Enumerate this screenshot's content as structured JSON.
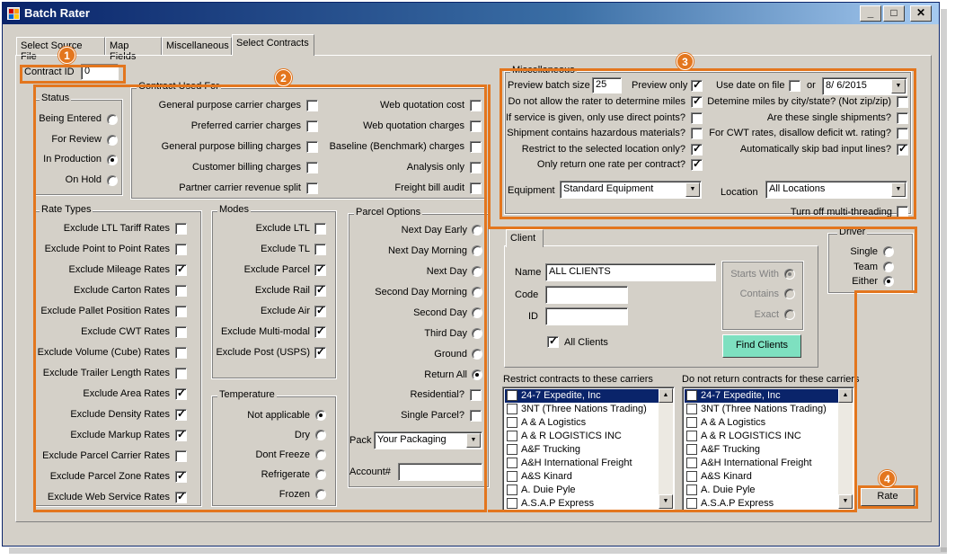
{
  "window": {
    "title": "Batch Rater",
    "minimize": "_",
    "maximize": "□",
    "close": "✕"
  },
  "tabs": [
    {
      "label": "Select Source File"
    },
    {
      "label": "Map Fields"
    },
    {
      "label": "Miscellaneous"
    },
    {
      "label": "Select Contracts"
    }
  ],
  "contract_id": {
    "label": "Contract ID",
    "value": "0"
  },
  "badges": [
    "1",
    "2",
    "3",
    "4"
  ],
  "status": {
    "title": "Status",
    "options": [
      {
        "label": "Being Entered",
        "selected": false
      },
      {
        "label": "For Review",
        "selected": false
      },
      {
        "label": "In Production",
        "selected": true
      },
      {
        "label": "On Hold",
        "selected": false
      }
    ]
  },
  "contract_used_for": {
    "title": "Contract Used For",
    "left": [
      {
        "label": "General purpose carrier charges",
        "checked": false
      },
      {
        "label": "Preferred carrier charges",
        "checked": false
      },
      {
        "label": "General purpose billing charges",
        "checked": false
      },
      {
        "label": "Customer billing charges",
        "checked": false
      },
      {
        "label": "Partner carrier revenue split",
        "checked": false
      }
    ],
    "right": [
      {
        "label": "Web quotation cost",
        "checked": false
      },
      {
        "label": "Web quotation charges",
        "checked": false
      },
      {
        "label": "Baseline (Benchmark) charges",
        "checked": false
      },
      {
        "label": "Analysis only",
        "checked": false
      },
      {
        "label": "Freight bill audit",
        "checked": false
      }
    ]
  },
  "rate_types": {
    "title": "Rate Types",
    "items": [
      {
        "label": "Exclude LTL Tariff Rates",
        "checked": false
      },
      {
        "label": "Exclude Point to Point Rates",
        "checked": false
      },
      {
        "label": "Exclude Mileage Rates",
        "checked": true
      },
      {
        "label": "Exclude Carton Rates",
        "checked": false
      },
      {
        "label": "Exclude Pallet Position Rates",
        "checked": false
      },
      {
        "label": "Exclude CWT Rates",
        "checked": false
      },
      {
        "label": "Exclude Volume (Cube) Rates",
        "checked": false
      },
      {
        "label": "Exclude Trailer Length Rates",
        "checked": false
      },
      {
        "label": "Exclude Area Rates",
        "checked": true
      },
      {
        "label": "Exclude Density Rates",
        "checked": true
      },
      {
        "label": "Exclude Markup Rates",
        "checked": true
      },
      {
        "label": "Exclude Parcel Carrier Rates",
        "checked": false
      },
      {
        "label": "Exclude Parcel Zone Rates",
        "checked": true
      },
      {
        "label": "Exclude Web Service Rates",
        "checked": true
      }
    ]
  },
  "modes": {
    "title": "Modes",
    "items": [
      {
        "label": "Exclude LTL",
        "checked": false
      },
      {
        "label": "Exclude TL",
        "checked": false
      },
      {
        "label": "Exclude Parcel",
        "checked": true
      },
      {
        "label": "Exclude Rail",
        "checked": true
      },
      {
        "label": "Exclude Air",
        "checked": true
      },
      {
        "label": "Exclude Multi-modal",
        "checked": true
      },
      {
        "label": "Exclude Post (USPS)",
        "checked": true
      }
    ]
  },
  "temperature": {
    "title": "Temperature",
    "options": [
      {
        "label": "Not applicable",
        "selected": true
      },
      {
        "label": "Dry",
        "selected": false
      },
      {
        "label": "Dont Freeze",
        "selected": false
      },
      {
        "label": "Refrigerate",
        "selected": false
      },
      {
        "label": "Frozen",
        "selected": false
      }
    ]
  },
  "parcel_options": {
    "title": "Parcel Options",
    "options": [
      {
        "label": "Next Day Early",
        "selected": false
      },
      {
        "label": "Next Day Morning",
        "selected": false
      },
      {
        "label": "Next Day",
        "selected": false
      },
      {
        "label": "Second Day Morning",
        "selected": false
      },
      {
        "label": "Second Day",
        "selected": false
      },
      {
        "label": "Third Day",
        "selected": false
      },
      {
        "label": "Ground",
        "selected": false
      },
      {
        "label": "Return All",
        "selected": true
      }
    ],
    "residential": {
      "label": "Residential?",
      "checked": false
    },
    "single_parcel": {
      "label": "Single Parcel?",
      "checked": false
    },
    "pack_label": "Pack",
    "pack_value": "Your Packaging",
    "account_label": "Account#",
    "account_value": ""
  },
  "misc": {
    "title": "Miscellaneous",
    "preview_batch_size_label": "Preview batch size",
    "preview_batch_size_value": "25",
    "preview_only": {
      "label": "Preview only",
      "checked": true
    },
    "use_date_on_file": {
      "label": "Use date on file",
      "checked": false
    },
    "or_label": "or",
    "date_value": "8/ 6/2015",
    "left_checks": [
      {
        "label": "Do not allow the rater to determine miles",
        "checked": true
      },
      {
        "label": "If service is given, only use direct points?",
        "checked": false
      },
      {
        "label": "Shipment contains hazardous materials?",
        "checked": false
      },
      {
        "label": "Restrict to the selected location only?",
        "checked": true
      },
      {
        "label": "Only return one rate per contract?",
        "checked": true
      }
    ],
    "right_checks": [
      {
        "label": "Detemine miles by city/state? (Not zip/zip)",
        "checked": false
      },
      {
        "label": "Are these single shipments?",
        "checked": false
      },
      {
        "label": "For CWT rates, disallow deficit wt. rating?",
        "checked": false
      },
      {
        "label": "Automatically skip bad input lines?",
        "checked": true
      }
    ],
    "equipment_label": "Equipment",
    "equipment_value": "Standard Equipment",
    "location_label": "Location",
    "location_value": "All Locations",
    "multithreading": {
      "label": "Turn off multi-threading",
      "checked": false
    }
  },
  "client": {
    "tab": "Client",
    "name_label": "Name",
    "name_value": "ALL CLIENTS",
    "code_label": "Code",
    "code_value": "",
    "id_label": "ID",
    "id_value": "",
    "match": [
      {
        "label": "Starts With",
        "selected": true
      },
      {
        "label": "Contains",
        "selected": false
      },
      {
        "label": "Exact",
        "selected": false
      }
    ],
    "all_clients": {
      "label": "All Clients",
      "checked": true
    },
    "find_button": "Find Clients"
  },
  "driver": {
    "title": "Driver",
    "options": [
      {
        "label": "Single",
        "selected": false
      },
      {
        "label": "Team",
        "selected": false
      },
      {
        "label": "Either",
        "selected": true
      }
    ]
  },
  "restrict_carriers": {
    "title": "Restrict contracts to these carriers",
    "items": [
      "24-7 Expedite, Inc",
      "3NT (Three Nations Trading)",
      "A & A Logistics",
      "A & R LOGISTICS INC",
      "A&F Trucking",
      "A&H International Freight",
      "A&S Kinard",
      "A. Duie Pyle",
      "A.S.A.P Express"
    ]
  },
  "exclude_carriers": {
    "title": "Do not return contracts for these carriers",
    "items": [
      "24-7 Expedite, Inc",
      "3NT (Three Nations Trading)",
      "A & A Logistics",
      "A & R LOGISTICS INC",
      "A&F Trucking",
      "A&H International Freight",
      "A&S Kinard",
      "A. Duie Pyle",
      "A.S.A.P Express"
    ]
  },
  "rate_button": "Rate",
  "accent_color": "#e3761e"
}
